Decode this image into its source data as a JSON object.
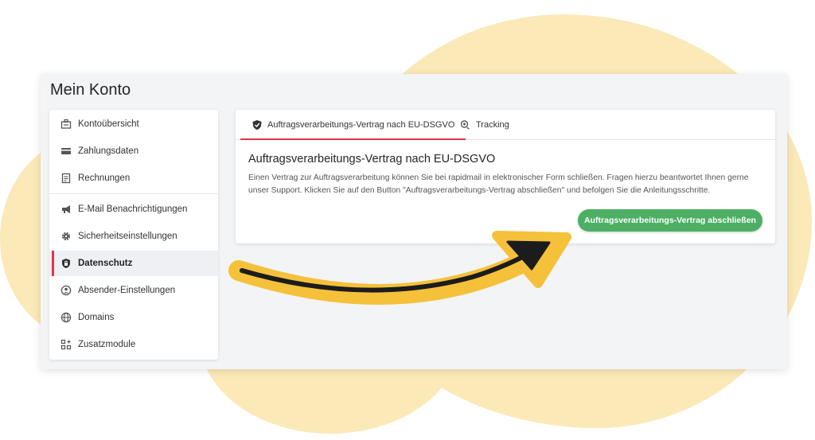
{
  "page": {
    "title": "Mein Konto"
  },
  "sidebar": {
    "items": [
      {
        "label": "Kontoübersicht",
        "icon": "account-overview-icon"
      },
      {
        "label": "Zahlungsdaten",
        "icon": "credit-card-icon"
      },
      {
        "label": "Rechnungen",
        "icon": "invoice-icon"
      },
      {
        "label": "E-Mail Benachrichtigungen",
        "icon": "megaphone-icon"
      },
      {
        "label": "Sicherheitseinstellungen",
        "icon": "gear-icon"
      },
      {
        "label": "Datenschutz",
        "icon": "shield-lock-icon",
        "active": true
      },
      {
        "label": "Absender-Einstellungen",
        "icon": "user-circle-icon"
      },
      {
        "label": "Domains",
        "icon": "globe-icon"
      },
      {
        "label": "Zusatzmodule",
        "icon": "modules-icon"
      }
    ]
  },
  "tabs": [
    {
      "label": "Auftragsverarbeitungs-Vertrag nach EU-DSGVO",
      "icon": "shield-icon",
      "active": true
    },
    {
      "label": "Tracking",
      "icon": "tracking-icon"
    }
  ],
  "content": {
    "heading": "Auftragsverarbeitungs-Vertrag nach EU-DSGVO",
    "text": "Einen Vertrag zur Auftragsverarbeitung können Sie bei rapidmail in elektronischer Form schließen. Fragen hierzu beantwortet Ihnen gerne unser Support. Klicken Sie auf den Button \"Auftragsverarbeitungs-Vertrag abschließen\" und befolgen Sie die Anleitungsschritte.",
    "button_label": "Auftragsverarbeitungs-Vertrag abschließen"
  },
  "colors": {
    "accent": "#e0344e",
    "button": "#4caf64",
    "highlight": "#f5c13a",
    "background_blob": "#fbe9b7"
  }
}
